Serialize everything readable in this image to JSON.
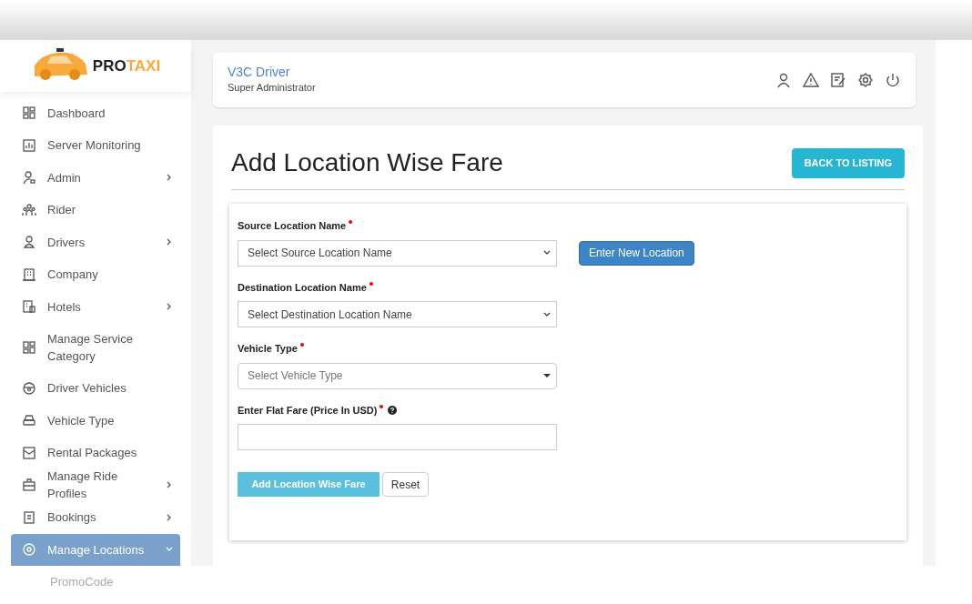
{
  "logo": {
    "part_1": "PRO",
    "part_2": "TAXI"
  },
  "sidebar": {
    "items": [
      {
        "label": "Dashboard",
        "has_submenu": false,
        "selected": false
      },
      {
        "label": "Server Monitoring",
        "has_submenu": false,
        "selected": false
      },
      {
        "label": "Admin",
        "has_submenu": true,
        "selected": false
      },
      {
        "label": "Rider",
        "has_submenu": false,
        "selected": false
      },
      {
        "label": "Drivers",
        "has_submenu": true,
        "selected": false
      },
      {
        "label": "Company",
        "has_submenu": false,
        "selected": false
      },
      {
        "label": "Hotels",
        "has_submenu": true,
        "selected": false
      },
      {
        "label": "Manage Service Category",
        "has_submenu": false,
        "selected": false
      },
      {
        "label": "Driver Vehicles",
        "has_submenu": false,
        "selected": false
      },
      {
        "label": "Vehicle Type",
        "has_submenu": false,
        "selected": false
      },
      {
        "label": "Rental Packages",
        "has_submenu": false,
        "selected": false
      },
      {
        "label": "Manage Ride Profiles",
        "has_submenu": true,
        "selected": false
      },
      {
        "label": "Bookings",
        "has_submenu": true,
        "selected": false
      },
      {
        "label": "Manage Locations",
        "has_submenu": true,
        "selected": true
      }
    ],
    "faded_item": {
      "label": "PromoCode"
    }
  },
  "header": {
    "user_name": "V3C Driver",
    "role": "Super Administrator"
  },
  "page": {
    "title": "Add Location Wise Fare",
    "back_button": "BACK TO LISTING"
  },
  "form": {
    "fields": [
      {
        "kind": "select",
        "label": "Source Location Name",
        "required": true,
        "help": false,
        "placeholder": "Select Source Location Name",
        "side_button": "Enter New Location"
      },
      {
        "kind": "select",
        "label": "Destination Location Name",
        "required": true,
        "help": false,
        "placeholder": "Select Destination Location Name"
      },
      {
        "kind": "dropdown",
        "label": "Vehicle Type",
        "required": true,
        "help": false,
        "placeholder": "Select Vehicle Type"
      },
      {
        "kind": "input",
        "label": "Enter Flat Fare (Price In USD)",
        "required": true,
        "help": true
      }
    ],
    "submit_button": "Add Location Wise Fare",
    "reset_button": "Reset"
  }
}
